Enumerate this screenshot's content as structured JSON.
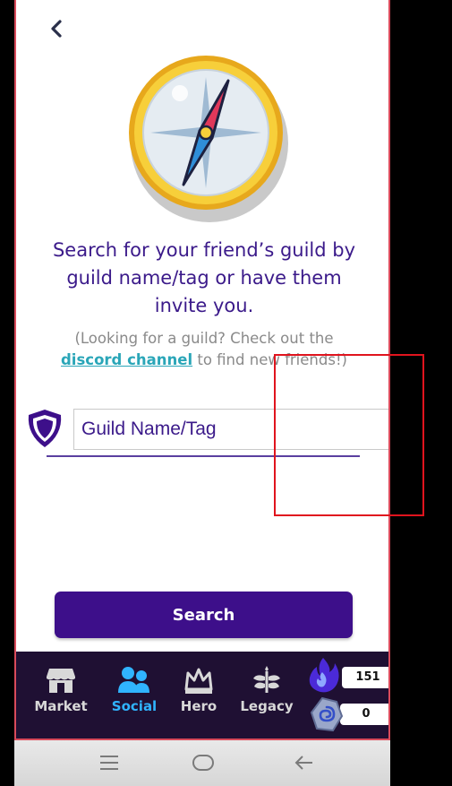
{
  "header": {
    "back_icon": "chevron-left-icon"
  },
  "main": {
    "headline": "Search for your friend’s guild by guild name/tag or have them invite you.",
    "hint_before": "(Looking for a guild? Check out the",
    "hint_link": "discord channel",
    "hint_after": "to find new friends!)",
    "guild_input": {
      "placeholder": "Guild Name/Tag",
      "value": ""
    },
    "search_button": "Search"
  },
  "tabbar": {
    "tabs": [
      {
        "label": "Market",
        "icon": "store-icon",
        "active": false
      },
      {
        "label": "Social",
        "icon": "people-icon",
        "active": true
      },
      {
        "label": "Hero",
        "icon": "crown-icon",
        "active": false
      },
      {
        "label": "Legacy",
        "icon": "laurel-icon",
        "active": false
      }
    ],
    "currencies": [
      {
        "icon": "flame-icon",
        "value": "151"
      },
      {
        "icon": "crystal-icon",
        "value": "0"
      }
    ]
  },
  "system_nav": {
    "icons": [
      "menu-icon",
      "home-icon",
      "back-arrow-icon"
    ]
  },
  "colors": {
    "primary": "#3d0f8a",
    "headline": "#3b1a8a",
    "link": "#2aa6b8",
    "tabbar": "#1f1033",
    "active_tab": "#30b4ff",
    "frame": "#d94b5b"
  }
}
